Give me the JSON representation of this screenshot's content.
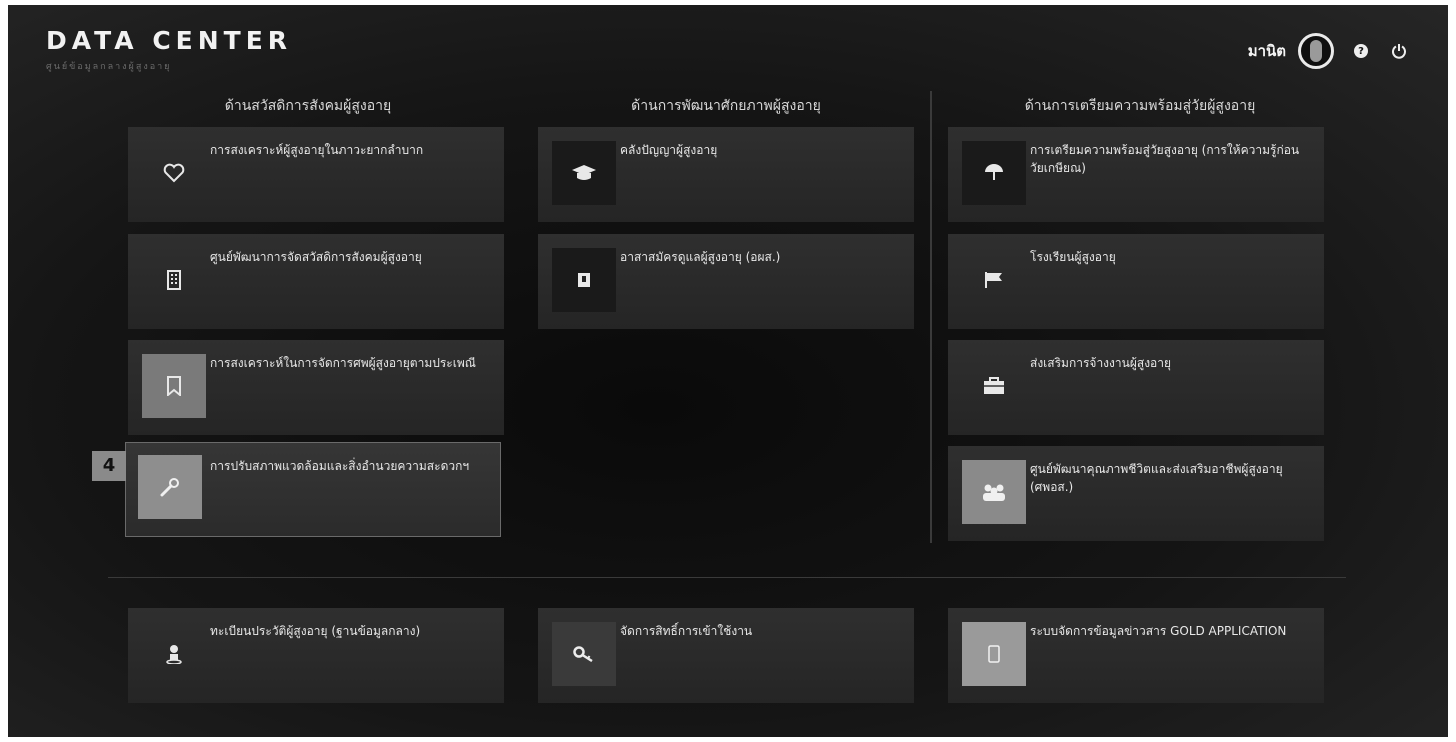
{
  "header": {
    "title": "DATA CENTER",
    "subtitle": "ศูนย์ข้อมูลกลางผู้สูงอายุ",
    "username": "มานิต",
    "icons": {
      "avatar": "user-avatar",
      "help": "question-icon",
      "logout": "power-icon"
    }
  },
  "columns": [
    {
      "heading": "ด้านสวัสดิการสังคมผู้สูงอายุ"
    },
    {
      "heading": "ด้านการพัฒนาศักยภาพผู้สูงอายุ"
    },
    {
      "heading": "ด้านการเตรียมความพร้อมสู่วัยผู้สูงอายุ"
    }
  ],
  "tiles": {
    "welfare_hardship": {
      "label": "การสงเคราะห์ผู้สูงอายุในภาวะยากลำบาก",
      "icon": "heart-icon"
    },
    "welfare_center": {
      "label": "ศูนย์พัฒนาการจัดสวัสดิการสังคมผู้สูงอายุ",
      "icon": "building-icon"
    },
    "funeral": {
      "label": "การสงเคราะห์ในการจัดการศพผู้สูงอายุตามประเพณี",
      "icon": "bookmark-icon"
    },
    "environment": {
      "label": "การปรับสภาพแวดล้อมและสิ่งอำนวยความสะดวกฯ",
      "icon": "wrench-icon",
      "badge": "4"
    },
    "wisdom": {
      "label": "คลังปัญญาผู้สูงอายุ",
      "icon": "graduation-cap-icon"
    },
    "volunteer": {
      "label": "อาสาสมัครดูแลผู้สูงอายุ (อผส.)",
      "icon": "id-badge-icon"
    },
    "preparation": {
      "label": "การเตรียมความพร้อมสู่วัยสูงอายุ (การให้ความรู้ก่อนวัยเกษียณ)",
      "icon": "umbrella-icon"
    },
    "school": {
      "label": "โรงเรียนผู้สูงอายุ",
      "icon": "flag-icon"
    },
    "employment": {
      "label": "ส่งเสริมการจ้างงานผู้สูงอายุ",
      "icon": "briefcase-icon"
    },
    "quality_center": {
      "label": "ศูนย์พัฒนาคุณภาพชีวิตและส่งเสริมอาชีพผู้สูงอายุ (ศพอส.)",
      "icon": "group-icon"
    },
    "registry": {
      "label": "ทะเบียนประวัติผู้สูงอายุ (ฐานข้อมูลกลาง)",
      "icon": "person-icon"
    },
    "access": {
      "label": "จัดการสิทธิ์การเข้าใช้งาน",
      "icon": "key-icon"
    },
    "gold_app": {
      "label": "ระบบจัดการข้อมูลข่าวสาร GOLD APPLICATION",
      "icon": "mobile-icon"
    }
  }
}
